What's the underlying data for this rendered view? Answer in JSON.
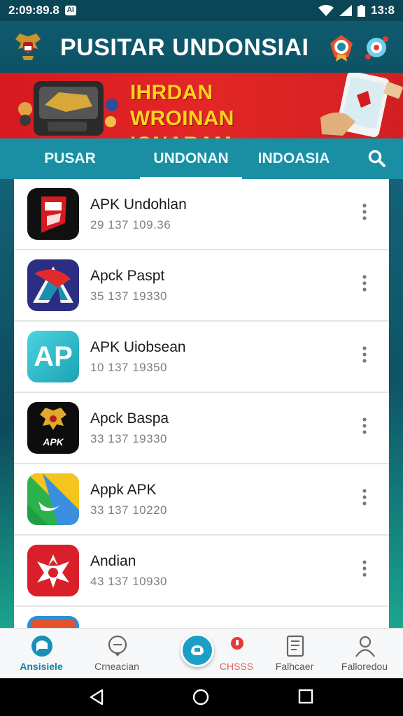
{
  "status_bar": {
    "time": "2:09:89.8",
    "badge": "AI",
    "battery_time": "13:8"
  },
  "header": {
    "title": "PUSITAR UNDONSIAI"
  },
  "banner": {
    "line1": "IHRDAN WROINAN",
    "line2": "IONARAM UNIBADEUS"
  },
  "tabs": [
    {
      "label": "PUSAR"
    },
    {
      "label": "UNDONAN",
      "active": true
    },
    {
      "label": "INDOASIA"
    }
  ],
  "apps": [
    {
      "name": "APK Undohlan",
      "size": "29 137 109.36",
      "icon": "red-shield-app-icon",
      "icon_label": ""
    },
    {
      "name": "Apck Paspt",
      "size": "35 137 19330",
      "icon": "blue-triangle-app-icon"
    },
    {
      "name": "APK Uiobsean",
      "size": "10 137 19350",
      "icon": "ap-logo-app-icon",
      "icon_label": "AP"
    },
    {
      "name": "Apck Baspa",
      "size": "33 137 19330",
      "icon": "garuda-apk-app-icon",
      "icon_label": "APK"
    },
    {
      "name": "Appk APK",
      "size": "33 137 10220",
      "icon": "green-yellow-app-icon"
    },
    {
      "name": "Andian",
      "size": "43 137 10930",
      "icon": "red-emblem-app-icon"
    }
  ],
  "bottom_nav": [
    {
      "label": "Ansisiele",
      "icon": "chat-bubble-icon",
      "active": true
    },
    {
      "label": "Crneacian",
      "icon": "message-icon"
    },
    {
      "label": "",
      "icon": "center-app-icon"
    },
    {
      "label": "CHSSS",
      "icon": "notification-icon"
    },
    {
      "label": "Falhcaer",
      "icon": "document-icon"
    },
    {
      "label": "Falloredou",
      "icon": "profile-icon"
    }
  ],
  "colors": {
    "header_bg": "#0f5a6d",
    "tab_bg": "#1a8fa4",
    "banner_bg": "#d71920",
    "banner_text": "#ffd21f",
    "accent": "#1582a8"
  }
}
